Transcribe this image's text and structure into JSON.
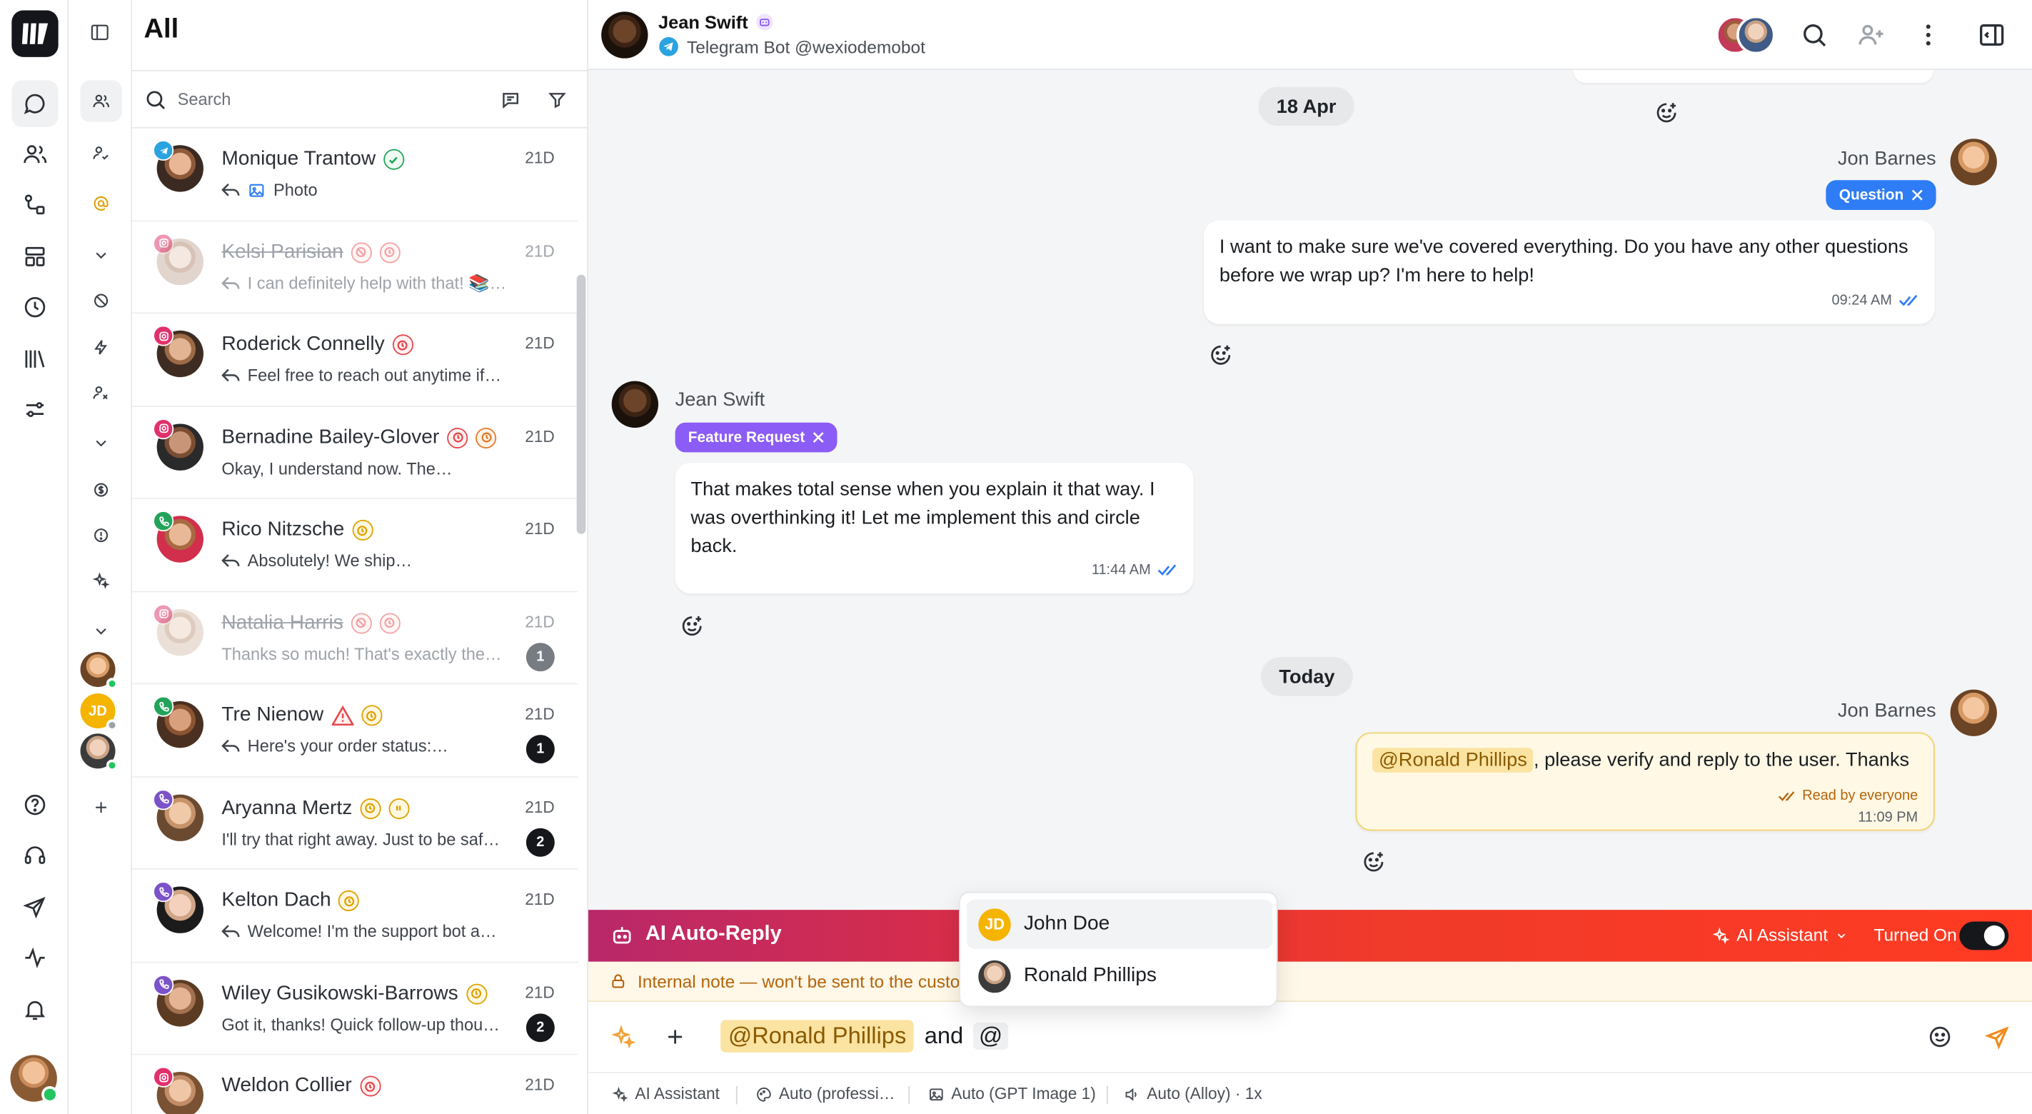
{
  "colors": {
    "accent_blue": "#2f7df6",
    "feature_purple": "#8b5cf6",
    "online_green": "#22c55e",
    "mention_bg": "#fbe3a1",
    "ai_gradient_start": "#b9286a",
    "ai_gradient_end": "#ff3b22"
  },
  "list": {
    "title": "All",
    "search_placeholder": "Search",
    "conversations": [
      {
        "name": "Monique Trantow",
        "preview": "Photo",
        "time": "21D",
        "channel": "telegram",
        "muted": false,
        "statuses": [
          "green"
        ],
        "reply": true,
        "photo": true,
        "badge": null
      },
      {
        "name": "Kelsi Parisian",
        "preview": "I can definitely help with that! 📚…",
        "time": "21D",
        "channel": "instagram",
        "muted": true,
        "statuses": [
          "red-faint-block",
          "red-faint"
        ],
        "reply": true,
        "badge": null
      },
      {
        "name": "Roderick Connelly",
        "preview": "Feel free to reach out anytime if…",
        "time": "21D",
        "channel": "instagram",
        "muted": false,
        "statuses": [
          "red"
        ],
        "reply": true,
        "badge": null
      },
      {
        "name": "Bernadine Bailey-Glover",
        "preview": "Okay, I understand now. The…",
        "time": "21D",
        "channel": "instagram",
        "muted": false,
        "statuses": [
          "red",
          "orange"
        ],
        "reply": false,
        "badge": null
      },
      {
        "name": "Rico Nitzsche",
        "preview": "Absolutely! We ship…",
        "time": "21D",
        "channel": "phone",
        "muted": false,
        "statuses": [
          "amber"
        ],
        "reply": true,
        "badge": null
      },
      {
        "name": "Natalia Harris",
        "preview": "Thanks so much! That's exactly the…",
        "time": "21D",
        "channel": "instagram",
        "muted": true,
        "statuses": [
          "red-faint-block",
          "red-faint"
        ],
        "reply": false,
        "badge": "1"
      },
      {
        "name": "Tre Nienow",
        "preview": "Here's your order status:…",
        "time": "21D",
        "channel": "phone",
        "muted": false,
        "statuses": [
          "red-warn",
          "amber"
        ],
        "reply": true,
        "badge": "1"
      },
      {
        "name": "Aryanna Mertz",
        "preview": "I'll try that right away. Just to be saf…",
        "time": "21D",
        "channel": "viber",
        "muted": false,
        "statuses": [
          "amber",
          "amber-pause"
        ],
        "reply": false,
        "badge": "2"
      },
      {
        "name": "Kelton Dach",
        "preview": "Welcome! I'm the support bot a…",
        "time": "21D",
        "channel": "viber",
        "muted": false,
        "statuses": [
          "amber"
        ],
        "reply": true,
        "badge": null
      },
      {
        "name": "Wiley Gusikowski-Barrows",
        "preview": "Got it, thanks! Quick follow-up thou…",
        "time": "21D",
        "channel": "viber",
        "muted": false,
        "statuses": [
          "amber"
        ],
        "reply": false,
        "badge": "2"
      },
      {
        "name": "Weldon Collier",
        "preview": "",
        "time": "21D",
        "channel": "instagram",
        "muted": false,
        "statuses": [
          "red"
        ],
        "reply": false,
        "badge": null
      }
    ]
  },
  "chat": {
    "contact_name": "Jean Swift",
    "contact_sub": "Telegram Bot @wexiodemobot",
    "date_1": "18 Apr",
    "date_2": "Today",
    "messages": [
      {
        "sender": "Jon Barnes",
        "tag": "Question",
        "text": "I want to make sure we've covered everything. Do you have any other questions before we wrap up? I'm here to help!",
        "time": "09:24 AM"
      },
      {
        "sender": "Jean Swift",
        "tag": "Feature Request",
        "text": "That makes total sense when you explain it that way. I was overthinking it! Let me implement this and circle back.",
        "time": "11:44 AM"
      },
      {
        "sender": "Jon Barnes",
        "mention": "@Ronald Phillips",
        "text": ", please verify and reply to the user. Thanks",
        "read_status": "Read by everyone",
        "time": "11:09 PM"
      }
    ]
  },
  "composer": {
    "ai_autoreply": "AI Auto-Reply",
    "ai_assistant": "AI Assistant",
    "turned_on": "Turned On",
    "internal_note": "Internal note — won't be sent to the custon",
    "draft_mention": "@Ronald Phillips",
    "draft_and": "and",
    "draft_at": "@",
    "mention_options": [
      {
        "initials": "JD",
        "name": "John Doe"
      },
      {
        "initials": "",
        "name": "Ronald Phillips"
      }
    ],
    "toolbar": {
      "ai_assistant": "AI Assistant",
      "style": "Auto (professi…",
      "image_model": "Auto (GPT Image 1)",
      "voice": "Auto (Alloy) · 1x"
    }
  }
}
